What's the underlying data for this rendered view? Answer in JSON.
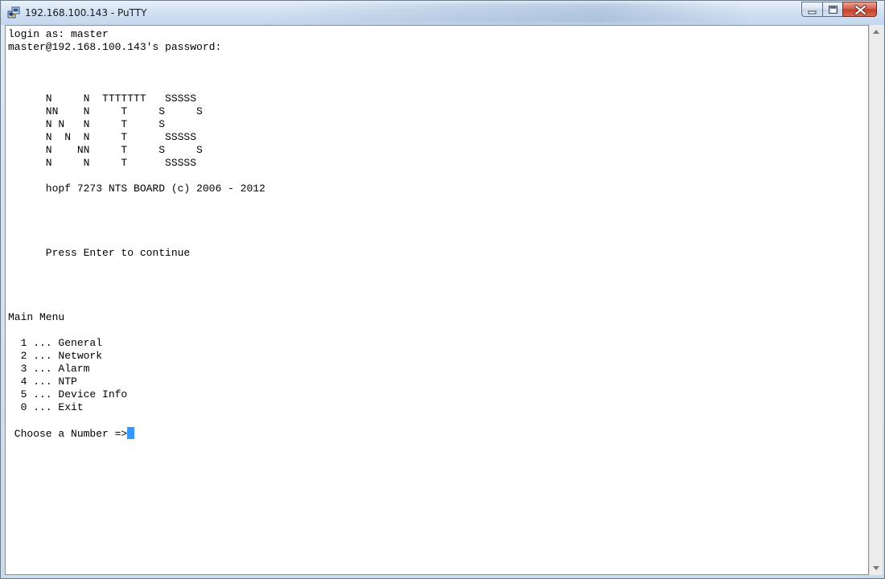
{
  "window": {
    "title": "192.168.100.143 - PuTTY",
    "app_icon": "putty-icon",
    "controls": {
      "minimize_icon": "minimize-icon",
      "maximize_icon": "maximize-icon",
      "close_icon": "close-icon"
    }
  },
  "terminal": {
    "lines": [
      "login as: master",
      "master@192.168.100.143's password:",
      "",
      "",
      "",
      "      N     N  TTTTTTT   SSSSS",
      "      NN    N     T     S     S",
      "      N N   N     T     S",
      "      N  N  N     T      SSSSS",
      "      N    NN     T     S     S",
      "      N     N     T      SSSSS",
      "",
      "      hopf 7273 NTS BOARD (c) 2006 - 2012",
      "",
      "",
      "",
      "",
      "      Press Enter to continue",
      "",
      "",
      "",
      "",
      "Main Menu",
      "",
      "  1 ... General",
      "  2 ... Network",
      "  3 ... Alarm",
      "  4 ... NTP",
      "  5 ... Device Info",
      "  0 ... Exit",
      "",
      " Choose a Number =>"
    ],
    "prompt": " Choose a Number =>",
    "cursor_color": "#3399ff",
    "background_color": "#ffffff",
    "text_color": "#000000"
  },
  "scrollbar": {
    "up_icon": "scroll-up-arrow-icon",
    "down_icon": "scroll-down-arrow-icon"
  }
}
